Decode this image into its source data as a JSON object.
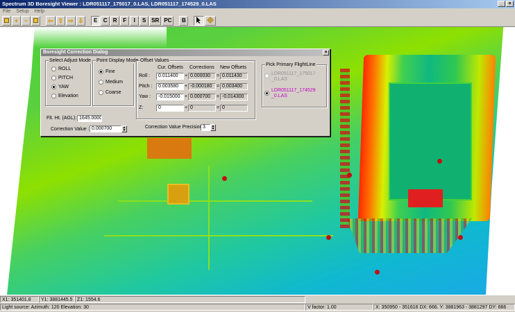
{
  "window": {
    "title": "Spectrum 3D Boresight Viewer  : LDR051117_175017_0.LAS, LDR051117_174529_0.LAS",
    "minimize": "_",
    "close": "×"
  },
  "menu": [
    "File",
    "Setup",
    "Help"
  ],
  "toolbar": {
    "icons": [
      "square-tool-icon",
      "zoom-in-icon",
      "zoom-out-icon",
      "fit-icon",
      "arrow-left-icon",
      "arrow-up-icon",
      "arrow-right-icon",
      "arrow-down-icon"
    ],
    "buttons": [
      "E",
      "C",
      "R",
      "F",
      "I",
      "S",
      "SR",
      "PC",
      "B"
    ],
    "pressed": "E",
    "pointer_icon": "pointer-icon",
    "crosshair_icon": "crosshair-icon"
  },
  "dialog": {
    "title": "Boresight Correction Dialog",
    "close": "×",
    "adjust_mode": {
      "title": "Select Adjust Mode",
      "options": [
        "ROLL",
        "PITCH",
        "YAW",
        "Elevation"
      ],
      "selected": "YAW"
    },
    "point_display": {
      "title": "Point Display Mode",
      "options": [
        "Fine",
        "Medium",
        "Coarse"
      ],
      "selected": "Fine"
    },
    "offset_values": {
      "title": "Offset Values",
      "col_cur": "Cur. Offsets",
      "col_corr": "Corrections",
      "col_new": "New Offsets",
      "rows": [
        {
          "label": "Roll :",
          "cur": "0.011400",
          "op1": "+",
          "corr": "0.000030",
          "op2": "=",
          "new": "0.011430"
        },
        {
          "label": "Pitch :",
          "cur": "0.003580",
          "op1": "+",
          "corr": "-0.000180",
          "op2": "=",
          "new": "0.003400"
        },
        {
          "label": "Yaw :",
          "cur": "-0.015000",
          "op1": "+",
          "corr": "0.000700",
          "op2": "=",
          "new": "-0.014300"
        },
        {
          "label": "Z:",
          "cur": "0",
          "op1": "+",
          "corr": "0",
          "op2": "=",
          "new": "0"
        }
      ]
    },
    "pick_flightline": {
      "title": "Pick Primary FlightLine",
      "options": [
        "LDR051117_175017\n_0.LAS",
        "LDR051117_174529\n_0.LAS"
      ],
      "selected_index": 1,
      "selected_color": "#c000c0",
      "disabled_color": "#909090"
    },
    "flt_ht_label": "Flt. Ht. (AGL):",
    "flt_ht_value": "1645.0000",
    "correction_value_label": "Correction Value :",
    "correction_value": "0.000700",
    "precision_label": "Correction Value Precision :",
    "precision_value": "3"
  },
  "status": {
    "x1": "X1: 351401.8",
    "y1": "Y1: 3881445.5",
    "z1": "Z1: 1554.6",
    "light": "Light source: Azimuth: 120 Elevation: 30",
    "vfactor": "V factor: 1.00",
    "extent": "X: 350950 - 351616 DX: 666. Y: 3881963 - 3881297 DY: 666"
  }
}
